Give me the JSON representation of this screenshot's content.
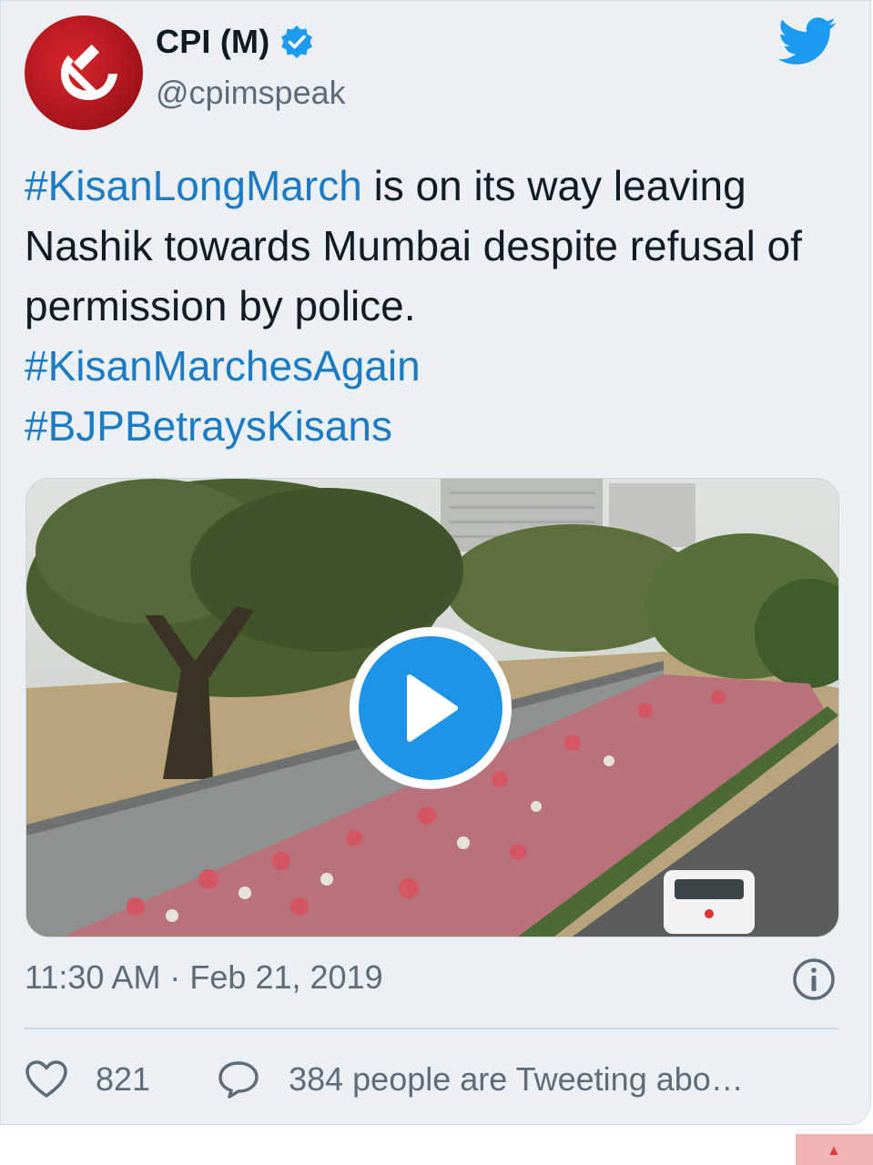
{
  "tweet": {
    "author": {
      "name": "CPI (M)",
      "handle": "@cpimspeak",
      "verified": true,
      "avatar_icon": "hammer-sickle-icon",
      "avatar_color": "#c8161d"
    },
    "text": {
      "hashtag_1": "#KisanLongMarch",
      "body": " is on its way leaving Nashik towards Mumbai despite refusal of permission by police.",
      "hashtag_2": "#KisanMarchesAgain",
      "hashtag_3": "#BJPBetraysKisans"
    },
    "media": {
      "type": "video",
      "play_icon": "play-icon"
    },
    "timestamp": "11:30 AM · Feb 21, 2019",
    "info_icon": "info-icon",
    "likes_count": "821",
    "replies_text": "384 people are Tweeting abo…",
    "accent_color": "#1d9bf0",
    "link_color": "#1d7bc4"
  },
  "brand_icon": "twitter-bird-icon"
}
